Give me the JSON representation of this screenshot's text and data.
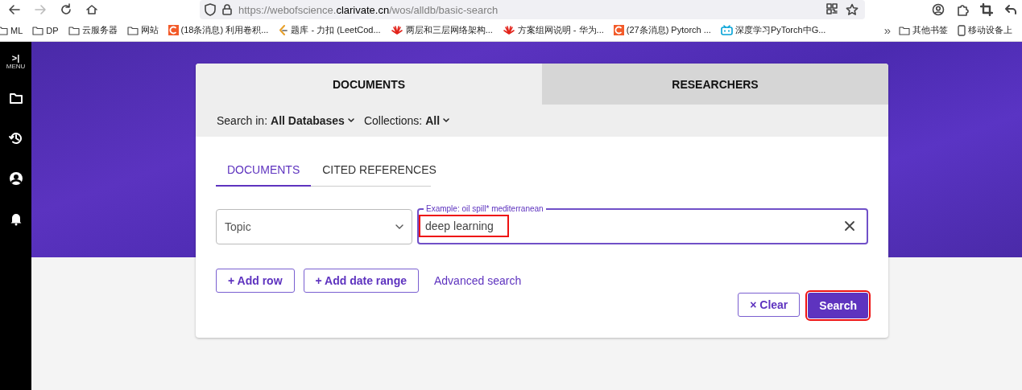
{
  "browser": {
    "nav": [
      {
        "kind": "back",
        "disabled": false
      },
      {
        "kind": "forward",
        "disabled": true
      },
      {
        "kind": "reload",
        "disabled": false
      },
      {
        "kind": "home",
        "disabled": false
      }
    ],
    "url": [
      {
        "text": "https://webofscience.",
        "emphasis": false
      },
      {
        "text": "clarivate.cn",
        "emphasis": true
      },
      {
        "text": "/wos/alldb/basic-search",
        "emphasis": false
      }
    ],
    "bookmarks": [
      {
        "kind": "folder",
        "label": "ML"
      },
      {
        "kind": "folder",
        "label": "DP"
      },
      {
        "kind": "folder",
        "label": "云服务器"
      },
      {
        "kind": "folder",
        "label": "网站"
      },
      {
        "kind": "csdn",
        "label": "(18条消息) 利用卷积..."
      },
      {
        "kind": "leetcode",
        "label": "题库 - 力扣 (LeetCod..."
      },
      {
        "kind": "huawei",
        "label": "两层和三层网络架构..."
      },
      {
        "kind": "huawei",
        "label": "方案组网说明 - 华为..."
      },
      {
        "kind": "csdn",
        "label": "(27条消息) Pytorch ..."
      },
      {
        "kind": "bilibili",
        "label": "深度学习PyTorch中G..."
      }
    ],
    "overflow": "»",
    "bookmarks_right": [
      {
        "kind": "folder",
        "label": "其他书签"
      },
      {
        "kind": "mobile",
        "label": "移动设备上"
      }
    ]
  },
  "sidebar": {
    "toggle": ">|",
    "label": "MENU",
    "items": [
      {
        "kind": "folder"
      },
      {
        "kind": "history"
      },
      {
        "kind": "account"
      },
      {
        "kind": "bell"
      }
    ]
  },
  "main_tabs": [
    {
      "label": "DOCUMENTS",
      "selected": true
    },
    {
      "label": "RESEARCHERS",
      "selected": false
    }
  ],
  "filters": [
    {
      "label": "Search in:",
      "value": "All Databases"
    },
    {
      "label": "Collections:",
      "value": "All"
    }
  ],
  "sub_tabs": [
    {
      "label": "DOCUMENTS",
      "selected": true
    },
    {
      "label": "CITED REFERENCES",
      "selected": false
    }
  ],
  "field_select": "Topic",
  "search_input": {
    "placeholder": "Example: oil spill* mediterranean",
    "value": "deep learning",
    "highlighted": true
  },
  "actions": [
    {
      "kind": "outline",
      "icon": "+",
      "label": "Add row"
    },
    {
      "kind": "outline",
      "icon": "+",
      "label": "Add date range"
    },
    {
      "kind": "link",
      "label": "Advanced search"
    }
  ],
  "buttons": [
    {
      "kind": "outline",
      "icon": "×",
      "label": "Clear",
      "highlighted": false
    },
    {
      "kind": "primary",
      "label": "Search",
      "highlighted": true
    }
  ]
}
